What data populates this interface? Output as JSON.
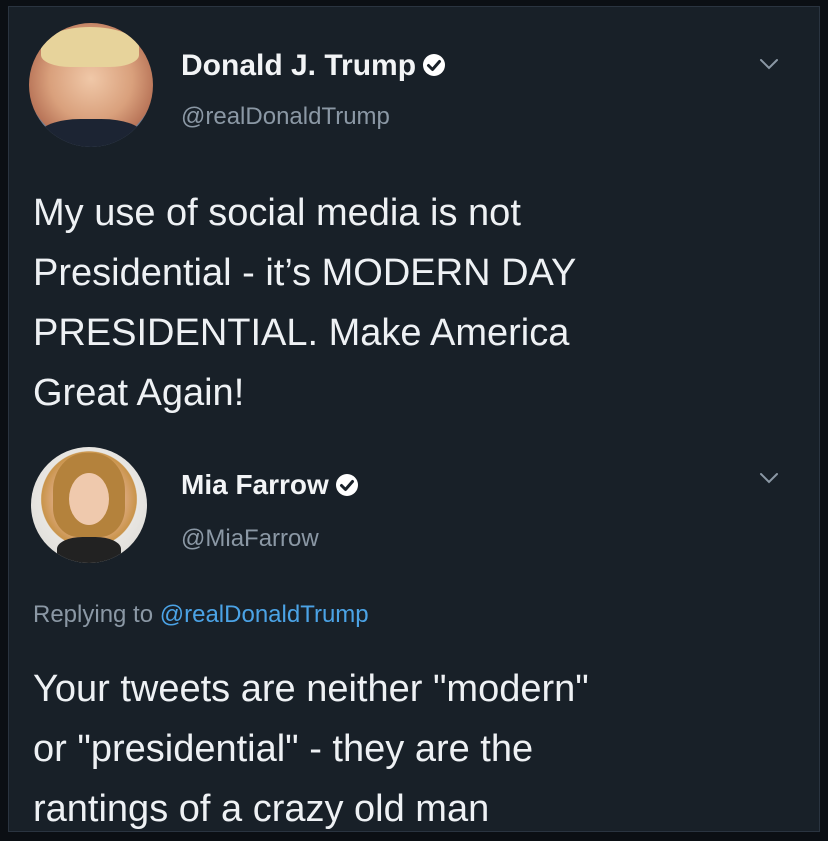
{
  "colors": {
    "background": "#182028",
    "text": "#eef1f4",
    "secondary_text": "#8b98a5",
    "link": "#4ba3e6"
  },
  "tweets": [
    {
      "author": {
        "name": "Donald J. Trump",
        "handle": "@realDonaldTrump",
        "verified": true
      },
      "text": "My use of social media is not\nPresidential - it’s MODERN DAY\nPRESIDENTIAL. Make America\nGreat Again!"
    },
    {
      "author": {
        "name": "Mia Farrow",
        "handle": "@MiaFarrow",
        "verified": true
      },
      "reply_prefix": "Replying to",
      "reply_mention": "@realDonaldTrump",
      "text": "Your tweets are neither \"modern\"\nor \"presidential\" - they are the\nrantings of a crazy old man"
    }
  ],
  "icons": {
    "verified": "verified-badge-icon",
    "menu": "chevron-down-icon"
  }
}
